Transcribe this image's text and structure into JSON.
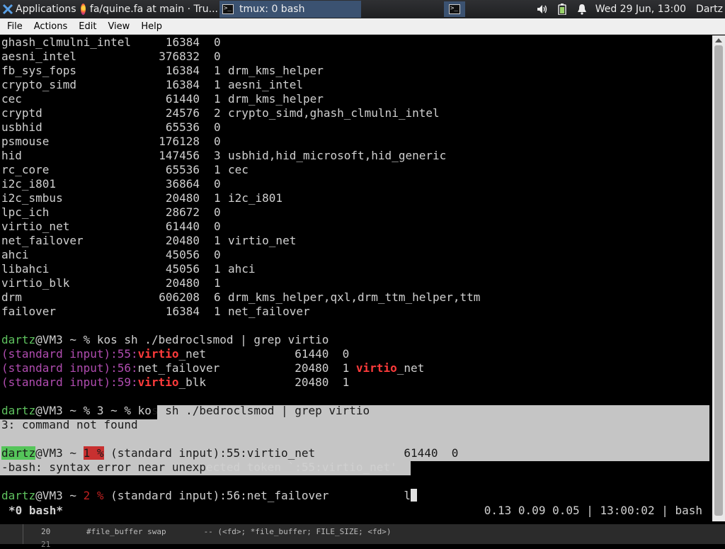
{
  "panel": {
    "apps_label": "Applications",
    "tasks": [
      {
        "label": "fa/quine.fa at main · Tru..."
      },
      {
        "label": "tmux: 0 bash"
      }
    ],
    "clock": "Wed 29 Jun, 13:00",
    "user": "Dartz"
  },
  "menu": [
    "File",
    "Actions",
    "Edit",
    "View",
    "Help"
  ],
  "modules": [
    {
      "name": "ghash_clmulni_intel",
      "size": "16384",
      "used": "0",
      "by": ""
    },
    {
      "name": "aesni_intel",
      "size": "376832",
      "used": "0",
      "by": ""
    },
    {
      "name": "fb_sys_fops",
      "size": "16384",
      "used": "1",
      "by": "drm_kms_helper"
    },
    {
      "name": "crypto_simd",
      "size": "16384",
      "used": "1",
      "by": "aesni_intel"
    },
    {
      "name": "cec",
      "size": "61440",
      "used": "1",
      "by": "drm_kms_helper"
    },
    {
      "name": "cryptd",
      "size": "24576",
      "used": "2",
      "by": "crypto_simd,ghash_clmulni_intel"
    },
    {
      "name": "usbhid",
      "size": "65536",
      "used": "0",
      "by": ""
    },
    {
      "name": "psmouse",
      "size": "176128",
      "used": "0",
      "by": ""
    },
    {
      "name": "hid",
      "size": "147456",
      "used": "3",
      "by": "usbhid,hid_microsoft,hid_generic"
    },
    {
      "name": "rc_core",
      "size": "65536",
      "used": "1",
      "by": "cec"
    },
    {
      "name": "i2c_i801",
      "size": "36864",
      "used": "0",
      "by": ""
    },
    {
      "name": "i2c_smbus",
      "size": "20480",
      "used": "1",
      "by": "i2c_i801"
    },
    {
      "name": "lpc_ich",
      "size": "28672",
      "used": "0",
      "by": ""
    },
    {
      "name": "virtio_net",
      "size": "61440",
      "used": "0",
      "by": ""
    },
    {
      "name": "net_failover",
      "size": "20480",
      "used": "1",
      "by": "virtio_net"
    },
    {
      "name": "ahci",
      "size": "45056",
      "used": "0",
      "by": ""
    },
    {
      "name": "libahci",
      "size": "45056",
      "used": "1",
      "by": "ahci"
    },
    {
      "name": "virtio_blk",
      "size": "20480",
      "used": "1",
      "by": ""
    },
    {
      "name": "drm",
      "size": "606208",
      "used": "6",
      "by": "drm_kms_helper,qxl,drm_ttm_helper,ttm"
    },
    {
      "name": "failover",
      "size": "16384",
      "used": "1",
      "by": "net_failover"
    }
  ],
  "prompt": {
    "user": "dartz",
    "host": "@VM3 ~ % "
  },
  "cmd1": "kos sh ./bedroclsmod | grep virtio",
  "grep": {
    "src": "(standard input)",
    "r1_pre": ":55:",
    "r1_hl": "virtio",
    "r1_rest": "_net             61440  0",
    "r2_pre": ":56:",
    "r2_rest": "net_failover           20480  1 ",
    "r2_hl": "virtio",
    "r2_tail": "_net",
    "r3_pre": ":59:",
    "r3_hl": "virtio",
    "r3_rest": "_blk             20480  1"
  },
  "cmd2_a": "3 ~ % ko",
  "cmd2_b": "s sh ./bedroclsmod | grep virtio",
  "err1": "3: command not found",
  "p3_user": "dartz",
  "p3_host": "@VM3 ~ ",
  "p3_status": "1 %",
  "cmd3": " (standard input):55:virtio_net             61440  0",
  "err2_a": "-bash: syntax error near unexp",
  "err2_b": "ected token `:55:virtio_net'",
  "p4_host": "@VM3 ~ ",
  "p4_status": "2 %",
  "cmd4": " (standard input):56:net_failover           l",
  "status": {
    "window": "*0 bash*",
    "right": "0.13 0.09 0.05 | 13:00:02 | bash"
  },
  "editor": {
    "line_no": "20",
    "code": "#file_buffer swap        -- (<fd>; *file_buffer; FILE_SIZE; <fd>)",
    "line_no2": "21"
  }
}
